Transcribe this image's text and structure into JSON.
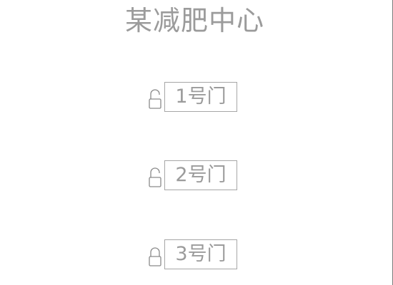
{
  "header": {
    "title": "某减肥中心"
  },
  "doors": [
    {
      "label": "1号门",
      "lock_state": "unlocked",
      "icon": "unlocked-padlock-icon"
    },
    {
      "label": "2号门",
      "lock_state": "unlocked",
      "icon": "unlocked-padlock-icon"
    },
    {
      "label": "3号门",
      "lock_state": "locked",
      "icon": "locked-padlock-icon"
    }
  ],
  "colors": {
    "text": "#9b9b9b",
    "border": "#a6a6a6",
    "icon": "#8a8a8a",
    "background": "#ffffff"
  }
}
